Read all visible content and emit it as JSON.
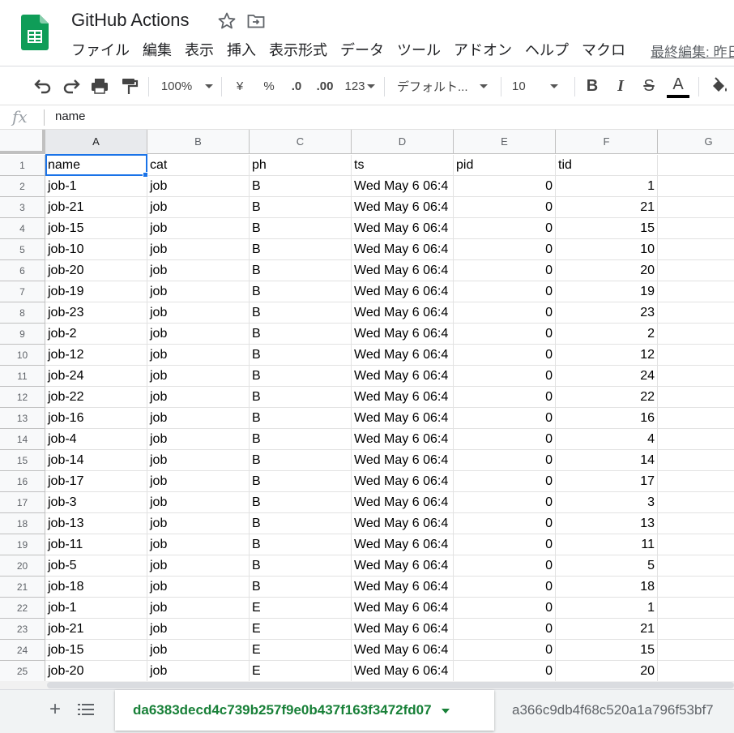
{
  "header": {
    "title": "GitHub Actions",
    "last_edit": "最終編集: 昨日",
    "menu": [
      "ファイル",
      "編集",
      "表示",
      "挿入",
      "表示形式",
      "データ",
      "ツール",
      "アドオン",
      "ヘルプ",
      "マクロ"
    ]
  },
  "toolbar": {
    "zoom": "100%",
    "currency": "¥",
    "percent": "%",
    "decrease_decimal": ".0",
    "increase_decimal": ".00",
    "format_more": "123",
    "font": "デフォルト...",
    "font_size": "10",
    "bold": "B",
    "italic": "I",
    "strike": "S",
    "text_color": "A"
  },
  "formula_bar": {
    "fx": "fx",
    "value": "name"
  },
  "grid": {
    "column_letters": [
      "A",
      "B",
      "C",
      "D",
      "E",
      "F",
      "G"
    ],
    "header_row": [
      "name",
      "cat",
      "ph",
      "ts",
      "pid",
      "tid"
    ],
    "rows": [
      [
        "job-1",
        "job",
        "B",
        "Wed May  6 06:4",
        "0",
        "1"
      ],
      [
        "job-21",
        "job",
        "B",
        "Wed May  6 06:4",
        "0",
        "21"
      ],
      [
        "job-15",
        "job",
        "B",
        "Wed May  6 06:4",
        "0",
        "15"
      ],
      [
        "job-10",
        "job",
        "B",
        "Wed May  6 06:4",
        "0",
        "10"
      ],
      [
        "job-20",
        "job",
        "B",
        "Wed May  6 06:4",
        "0",
        "20"
      ],
      [
        "job-19",
        "job",
        "B",
        "Wed May  6 06:4",
        "0",
        "19"
      ],
      [
        "job-23",
        "job",
        "B",
        "Wed May  6 06:4",
        "0",
        "23"
      ],
      [
        "job-2",
        "job",
        "B",
        "Wed May  6 06:4",
        "0",
        "2"
      ],
      [
        "job-12",
        "job",
        "B",
        "Wed May  6 06:4",
        "0",
        "12"
      ],
      [
        "job-24",
        "job",
        "B",
        "Wed May  6 06:4",
        "0",
        "24"
      ],
      [
        "job-22",
        "job",
        "B",
        "Wed May  6 06:4",
        "0",
        "22"
      ],
      [
        "job-16",
        "job",
        "B",
        "Wed May  6 06:4",
        "0",
        "16"
      ],
      [
        "job-4",
        "job",
        "B",
        "Wed May  6 06:4",
        "0",
        "4"
      ],
      [
        "job-14",
        "job",
        "B",
        "Wed May  6 06:4",
        "0",
        "14"
      ],
      [
        "job-17",
        "job",
        "B",
        "Wed May  6 06:4",
        "0",
        "17"
      ],
      [
        "job-3",
        "job",
        "B",
        "Wed May  6 06:4",
        "0",
        "3"
      ],
      [
        "job-13",
        "job",
        "B",
        "Wed May  6 06:4",
        "0",
        "13"
      ],
      [
        "job-11",
        "job",
        "B",
        "Wed May  6 06:4",
        "0",
        "11"
      ],
      [
        "job-5",
        "job",
        "B",
        "Wed May  6 06:4",
        "0",
        "5"
      ],
      [
        "job-18",
        "job",
        "B",
        "Wed May  6 06:4",
        "0",
        "18"
      ],
      [
        "job-1",
        "job",
        "E",
        "Wed May  6 06:4",
        "0",
        "1"
      ],
      [
        "job-21",
        "job",
        "E",
        "Wed May  6 06:4",
        "0",
        "21"
      ],
      [
        "job-15",
        "job",
        "E",
        "Wed May  6 06:4",
        "0",
        "15"
      ],
      [
        "job-20",
        "job",
        "E",
        "Wed May  6 06:4",
        "0",
        "20"
      ]
    ]
  },
  "sheets": {
    "active": "da6383decd4c739b257f9e0b437f163f3472fd07",
    "other": "a366c9db4f68c520a1a796f53bf7"
  },
  "colors": {
    "brand_green": "#188038",
    "selection_blue": "#1a73e8"
  }
}
